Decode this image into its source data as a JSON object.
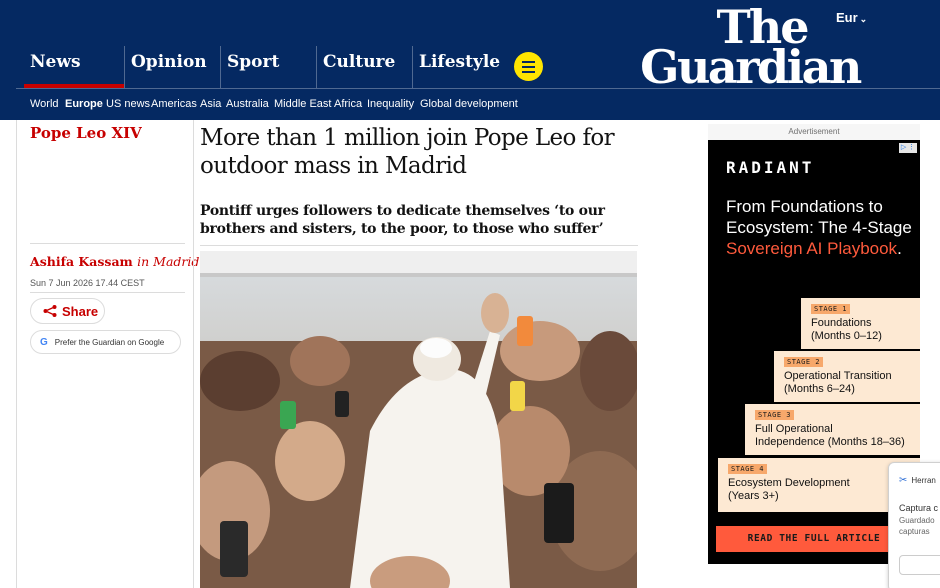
{
  "header": {
    "edition": "Eur",
    "logo_top": "The",
    "logo_bottom": "Guardian",
    "pillars": [
      {
        "label": "News"
      },
      {
        "label": "Opinion"
      },
      {
        "label": "Sport"
      },
      {
        "label": "Culture"
      },
      {
        "label": "Lifestyle"
      }
    ],
    "subnav": [
      "World",
      "Europe",
      "US news",
      "Americas",
      "Asia",
      "Australia",
      "Middle East",
      "Africa",
      "Inequality",
      "Global development"
    ],
    "colors": {
      "brand": "#052962",
      "accent": "#c70000",
      "menu": "#ffe500"
    }
  },
  "article": {
    "section": "Pope Leo XIV",
    "headline": "More than 1 million join Pope Leo for outdoor mass in Madrid",
    "standfirst": "Pontiff urges followers to dedicate themselves ‘to our brothers and sisters, to the poor, to those who suffer’",
    "author": "Ashifa Kassam",
    "author_location": "in Madrid",
    "date": "Sun 7 Jun 2026 17.44 CEST",
    "share_label": "Share",
    "google_label": "Prefer the Guardian on Google"
  },
  "ad": {
    "label": "Advertisement",
    "brand": "RADIANT",
    "copy_plain": "From Foundations to Ecosystem: The 4-Stage ",
    "copy_highlight": "Sovereign AI Playbook",
    "copy_end": ".",
    "stages": [
      {
        "tag": "STAGE 1",
        "line1": "Foundations",
        "line2": "(Months 0–12)"
      },
      {
        "tag": "STAGE 2",
        "line1": "Operational Transition",
        "line2": "(Months 6–24)"
      },
      {
        "tag": "STAGE 3",
        "line1": "Full Operational",
        "line2": "Independence (Months 18–36)"
      },
      {
        "tag": "STAGE 4",
        "line1": "Ecosystem Development",
        "line2": "(Years 3+)"
      }
    ],
    "cta": "READ THE FULL ARTICLE",
    "accent": "#ff5a3c"
  },
  "popup": {
    "title": "Herran",
    "line1": "Captura c",
    "line2": "Guardado",
    "line3": "capturas"
  }
}
